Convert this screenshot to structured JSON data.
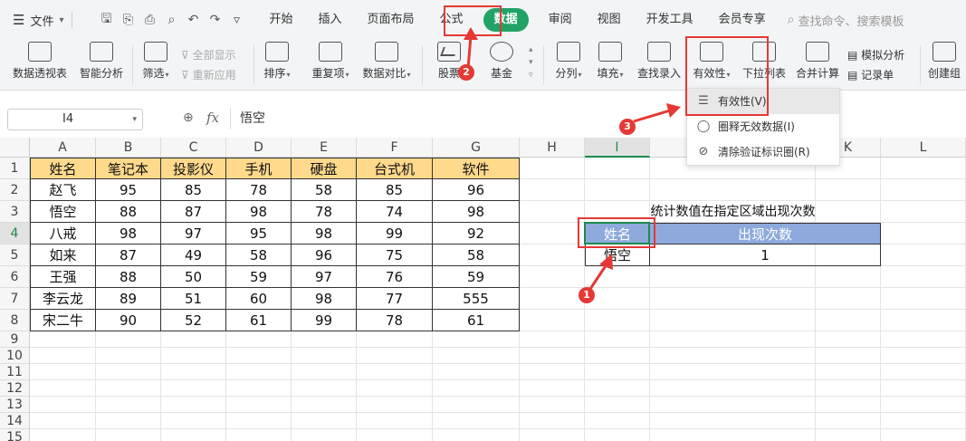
{
  "menubar": {
    "file_label": "文件",
    "tabs": [
      {
        "label": "开始"
      },
      {
        "label": "插入"
      },
      {
        "label": "页面布局"
      },
      {
        "label": "公式"
      },
      {
        "label": "数据"
      },
      {
        "label": "审阅"
      },
      {
        "label": "视图"
      },
      {
        "label": "开发工具"
      },
      {
        "label": "会员专享"
      }
    ],
    "search_placeholder": "查找命令、搜索模板"
  },
  "ribbon": {
    "pivot": "数据透视表",
    "smart": "智能分析",
    "filter": "筛选",
    "show_all": "全部显示",
    "reapply": "重新应用",
    "sort": "排序",
    "dup": "重复项",
    "compare": "数据对比",
    "stock": "股票",
    "fund": "基金",
    "split": "分列",
    "fill": "填充",
    "lookup": "查找录入",
    "validity": "有效性",
    "dropdown_list": "下拉列表",
    "merge_calc": "合并计算",
    "simulate": "模拟分析",
    "record": "记录单",
    "create_group": "创建组"
  },
  "formula_bar": {
    "name_box": "I4",
    "fx": "fx",
    "value": "悟空"
  },
  "columns": [
    "A",
    "B",
    "C",
    "D",
    "E",
    "F",
    "G",
    "H",
    "I",
    "J",
    "K",
    "L"
  ],
  "rows": [
    "1",
    "2",
    "3",
    "4",
    "5",
    "6",
    "7",
    "8",
    "9",
    "10",
    "11",
    "12",
    "13",
    "14",
    "15"
  ],
  "table": {
    "headers": [
      "姓名",
      "笔记本",
      "投影仪",
      "手机",
      "硬盘",
      "台式机",
      "软件"
    ],
    "rows": [
      [
        "赵飞",
        "95",
        "85",
        "78",
        "58",
        "85",
        "96"
      ],
      [
        "悟空",
        "88",
        "87",
        "98",
        "78",
        "74",
        "98"
      ],
      [
        "八戒",
        "98",
        "97",
        "95",
        "98",
        "99",
        "92"
      ],
      [
        "如来",
        "87",
        "49",
        "58",
        "96",
        "75",
        "58"
      ],
      [
        "王强",
        "88",
        "50",
        "59",
        "97",
        "76",
        "59"
      ],
      [
        "李云龙",
        "89",
        "51",
        "60",
        "98",
        "77",
        "555"
      ],
      [
        "宋二牛",
        "90",
        "52",
        "61",
        "99",
        "78",
        "61"
      ]
    ]
  },
  "stats": {
    "title": "统计数值在指定区域出现次数",
    "header_name": "姓名",
    "header_count": "出现次数",
    "name_value": "悟空",
    "count_value": "1"
  },
  "dropdown_menu": {
    "items": [
      {
        "label": "有效性(V)"
      },
      {
        "label": "圈释无效数据(I)"
      },
      {
        "label": "清除验证标识圈(R)"
      }
    ]
  },
  "annotations": {
    "badge1": "1",
    "badge2": "2",
    "badge3": "3"
  },
  "colors": {
    "accent": "#21a366",
    "header_fill": "#ffd98c",
    "stats_header_fill": "#8ea9db",
    "annotation": "#e53935"
  }
}
